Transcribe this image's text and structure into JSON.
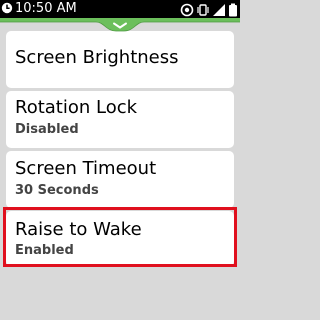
{
  "status_bar": {
    "time": "10:50 AM",
    "icons": [
      "clock-icon",
      "settings-icon",
      "vibrate-icon",
      "signal-icon",
      "battery-icon"
    ],
    "background": "#000000",
    "tab_color": "#6cbf5c"
  },
  "settings": [
    {
      "title": "Screen Brightness",
      "subtitle": ""
    },
    {
      "title": "Rotation Lock",
      "subtitle": "Disabled"
    },
    {
      "title": "Screen Timeout",
      "subtitle": "30 Seconds"
    },
    {
      "title": "Raise to Wake",
      "subtitle": "Enabled"
    }
  ],
  "highlight_color": "#e0101e"
}
